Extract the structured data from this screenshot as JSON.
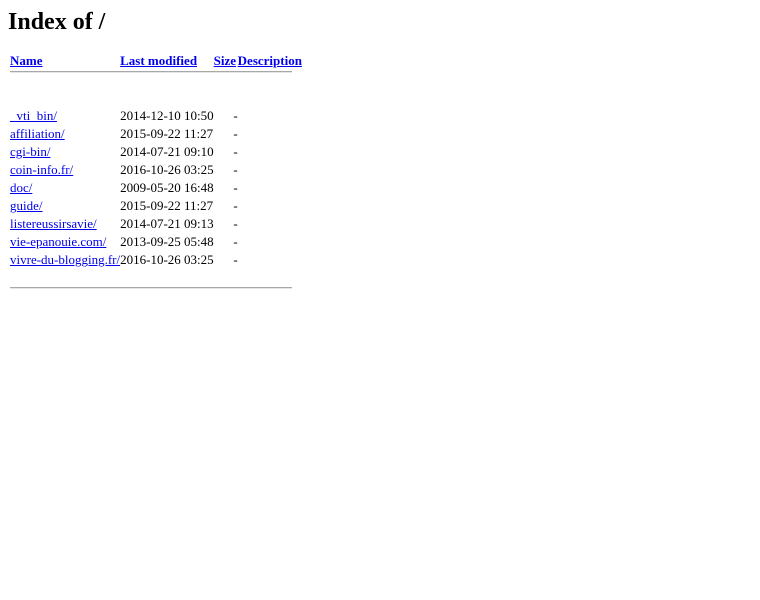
{
  "page": {
    "title": "Index of /"
  },
  "table": {
    "headers": {
      "name": "Name",
      "last_modified": "Last modified",
      "size": "Size",
      "description": "Description"
    },
    "rows": [
      {
        "name": "_vti_bin/",
        "last_modified": "2014-12-10 10:50",
        "size": "-",
        "description": ""
      },
      {
        "name": "affiliation/",
        "last_modified": "2015-09-22 11:27",
        "size": "-",
        "description": ""
      },
      {
        "name": "cgi-bin/",
        "last_modified": "2014-07-21 09:10",
        "size": "-",
        "description": ""
      },
      {
        "name": "coin-info.fr/",
        "last_modified": "2016-10-26 03:25",
        "size": "-",
        "description": ""
      },
      {
        "name": "doc/",
        "last_modified": "2009-05-20 16:48",
        "size": "-",
        "description": ""
      },
      {
        "name": "guide/",
        "last_modified": "2015-09-22 11:27",
        "size": "-",
        "description": ""
      },
      {
        "name": "listereussirsavie/",
        "last_modified": "2014-07-21 09:13",
        "size": "-",
        "description": ""
      },
      {
        "name": "vie-epanouie.com/",
        "last_modified": "2013-09-25 05:48",
        "size": "-",
        "description": ""
      },
      {
        "name": "vivre-du-blogging.fr/",
        "last_modified": "2016-10-26 03:25",
        "size": "-",
        "description": ""
      }
    ]
  },
  "colors": {
    "link": "#0000ee",
    "text": "#000000",
    "background": "#ffffff",
    "rule": "#a8a8a8"
  }
}
